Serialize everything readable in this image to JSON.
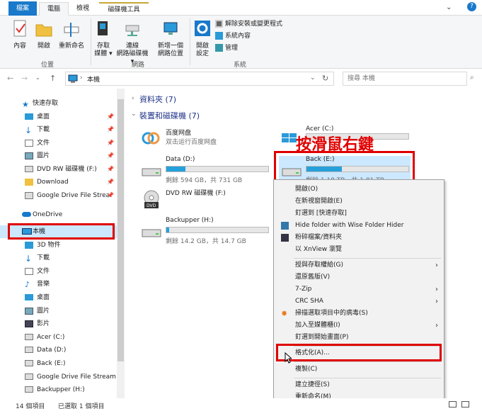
{
  "tabs": {
    "file": "檔案",
    "computer": "電腦",
    "view": "檢視",
    "drive_tools": "磁碟機工具"
  },
  "ribbon": {
    "properties": "內容",
    "open": "開啟",
    "rename": "重新命名",
    "group_location": "位置",
    "access_media_1": "存取",
    "access_media_2": "媒體",
    "map_drive_1": "連線",
    "map_drive_2": "網路磁碟機",
    "add_location_1": "新增一個",
    "add_location_2": "網路位置",
    "group_network": "網路",
    "open_settings_1": "開啟",
    "open_settings_2": "設定",
    "uninstall": "解除安裝或變更程式",
    "system_props": "系統內容",
    "manage": "管理",
    "group_system": "系統"
  },
  "address": {
    "path": "本機",
    "search_placeholder": "搜尋 本機"
  },
  "nav": {
    "quick_access": "快速存取",
    "desktop": "桌面",
    "downloads": "下載",
    "documents": "文件",
    "pictures": "圖片",
    "dvd": "DVD RW 磁碟機 (F:)",
    "download_folder": "Download",
    "gdrive_short": "Google Drive File Strea",
    "onedrive": "OneDrive",
    "this_pc": "本機",
    "objects3d": "3D 物件",
    "downloads2": "下載",
    "documents2": "文件",
    "music": "音樂",
    "desktop2": "桌面",
    "pictures2": "圖片",
    "videos": "影片",
    "acer": "Acer (C:)",
    "data": "Data (D:)",
    "back": "Back (E:)",
    "gdrive": "Google Drive File Stream",
    "backupper": "Backupper (H:)"
  },
  "content": {
    "folders_header": "資料夾 (7)",
    "drives_header": "裝置和磁碟機 (7)",
    "baidu_name": "百度网盘",
    "baidu_sub": "双击运行百度网盘",
    "acer_name": "Acer (C:)",
    "data_name": "Data (D:)",
    "data_free": "剩餘 594 GB，共 731 GB",
    "data_fill": 0.19,
    "back_name": "Back (E:)",
    "back_free": "剩餘 1.18 TB，共 1.81 TB",
    "back_fill": 0.35,
    "dvd_name": "DVD RW 磁碟機 (F:)",
    "backupper_name": "Backupper (H:)",
    "backupper_free": "剩餘 14.2 GB，共 14.7 GB",
    "backupper_fill": 0.03
  },
  "annotation": "按滑鼠右鍵",
  "menu": {
    "open": "開啟(O)",
    "open_new_window": "在新視窗開啟(E)",
    "pin_quick": "釘選到 [快速存取]",
    "hide_folder": "Hide folder with Wise Folder Hider",
    "shred": "粉碎檔案/資料夾",
    "xnview": "以 XnView 瀏覽",
    "give_access": "授與存取權給(G)",
    "restore": "還原舊版(V)",
    "zip": "7-Zip",
    "crc": "CRC SHA",
    "scan": "掃描選取項目中的病毒(S)",
    "library": "加入至媒體櫃(I)",
    "pin_start": "釘選到開始畫面(P)",
    "format": "格式化(A)...",
    "copy": "複製(C)",
    "shortcut": "建立捷徑(S)",
    "rename": "重新命名(M)"
  },
  "status": {
    "items": "14 個項目",
    "selected": "已選取 1 個項目"
  }
}
